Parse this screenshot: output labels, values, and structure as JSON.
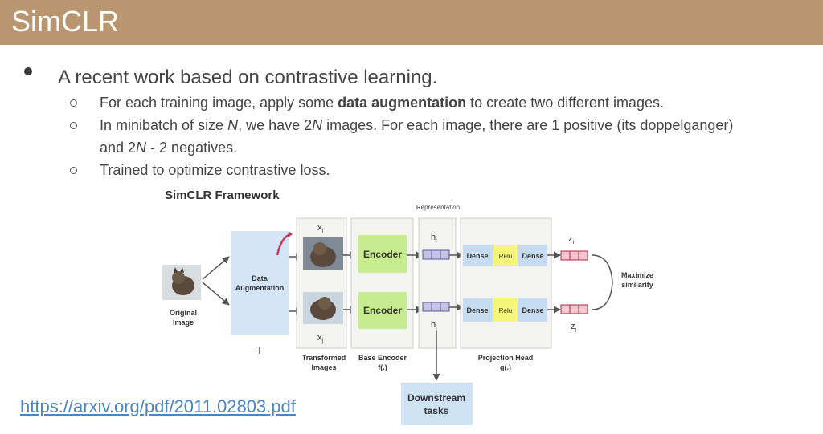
{
  "slide": {
    "title": "SimCLR",
    "bullet_main": "A recent work based on contrastive learning.",
    "sub1_a": "For each training image, apply some ",
    "sub1_b": "data augmentation",
    "sub1_c": " to create two different images.",
    "sub2_line1_a": "In minibatch of size ",
    "sub2_N": "N",
    "sub2_line1_b": ", we have 2",
    "sub2_line1_c": " images. For each image, there are 1 positive (its doppelganger)",
    "sub2_line2_a": "and 2",
    "sub2_line2_b": " - 2 negatives.",
    "sub3": "Trained to optimize contrastive loss.",
    "link": "https://arxiv.org/pdf/2011.02803.pdf"
  },
  "diagram": {
    "title": "SimCLR Framework",
    "representation": "Representation",
    "original_image_l1": "Original",
    "original_image_l2": "Image",
    "data_aug_l1": "Data",
    "data_aug_l2": "Augmentation",
    "t_label": "T",
    "xi": "x",
    "xi_sub": "i",
    "xj": "x",
    "xj_sub": "j",
    "encoder": "Encoder",
    "hi": "h",
    "hi_sub": "i",
    "hj": "h",
    "hj_sub": "j",
    "dense": "Dense",
    "relu": "Relu",
    "zi": "z",
    "zi_sub": "i",
    "zj": "z",
    "zj_sub": "j",
    "maximize_l1": "Maximize",
    "maximize_l2": "similarity",
    "transformed_l1": "Transformed",
    "transformed_l2": "Images",
    "base_encoder_l1": "Base Encoder",
    "base_encoder_l2": "f(.)",
    "projection_l1": "Projection Head",
    "projection_l2": "g(.)",
    "downstream_l1": "Downstream",
    "downstream_l2": "tasks"
  }
}
